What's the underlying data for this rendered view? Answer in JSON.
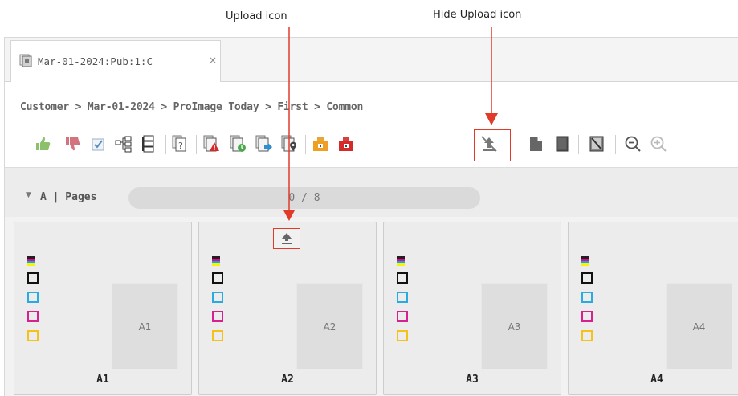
{
  "annotations": {
    "upload_icon": "Upload icon",
    "hide_upload_icon": "Hide Upload icon",
    "arrow_color": "#e03b2a"
  },
  "tab": {
    "icon": "document-stack-icon",
    "label": "Mar-01-2024:Pub:1:C",
    "close": "×"
  },
  "breadcrumb": "Customer > Mar-01-2024 > ProImage Today > First > Common",
  "toolbar": {
    "items": [
      {
        "icon": "thumbs-up-icon"
      },
      {
        "icon": "thumbs-down-icon"
      },
      {
        "icon": "checkbox-icon"
      },
      {
        "icon": "tree-structure-icon"
      },
      {
        "icon": "list-tree-icon"
      },
      {
        "icon": "page-query-icon"
      },
      {
        "icon": "page-warning-icon"
      },
      {
        "icon": "page-clock-icon"
      },
      {
        "icon": "page-forward-icon"
      },
      {
        "icon": "page-location-icon"
      },
      {
        "icon": "plate-orange-icon"
      },
      {
        "icon": "plate-red-icon"
      },
      {
        "icon": "hide-upload-icon",
        "highlighted": true
      },
      {
        "icon": "page-single-icon"
      },
      {
        "icon": "page-dark-icon"
      },
      {
        "icon": "page-crossed-icon"
      },
      {
        "icon": "zoom-out-icon"
      },
      {
        "icon": "zoom-in-icon"
      }
    ]
  },
  "pages_section": {
    "caret": "▼",
    "label": "A | Pages",
    "progress_text": "0 / 8",
    "progress_value": 0
  },
  "colorbar": {
    "cmyk": [
      "#00aeef",
      "#ec008c",
      "#fff200",
      "#231f20"
    ],
    "squares": [
      "#111111",
      "#29abe2",
      "#d6218e",
      "#f5c21b"
    ]
  },
  "pages": [
    {
      "name": "A1",
      "thumb_label": "A1",
      "show_upload": false
    },
    {
      "name": "A2",
      "thumb_label": "A2",
      "show_upload": true
    },
    {
      "name": "A3",
      "thumb_label": "A3",
      "show_upload": false
    },
    {
      "name": "A4",
      "thumb_label": "A4",
      "show_upload": false
    }
  ]
}
